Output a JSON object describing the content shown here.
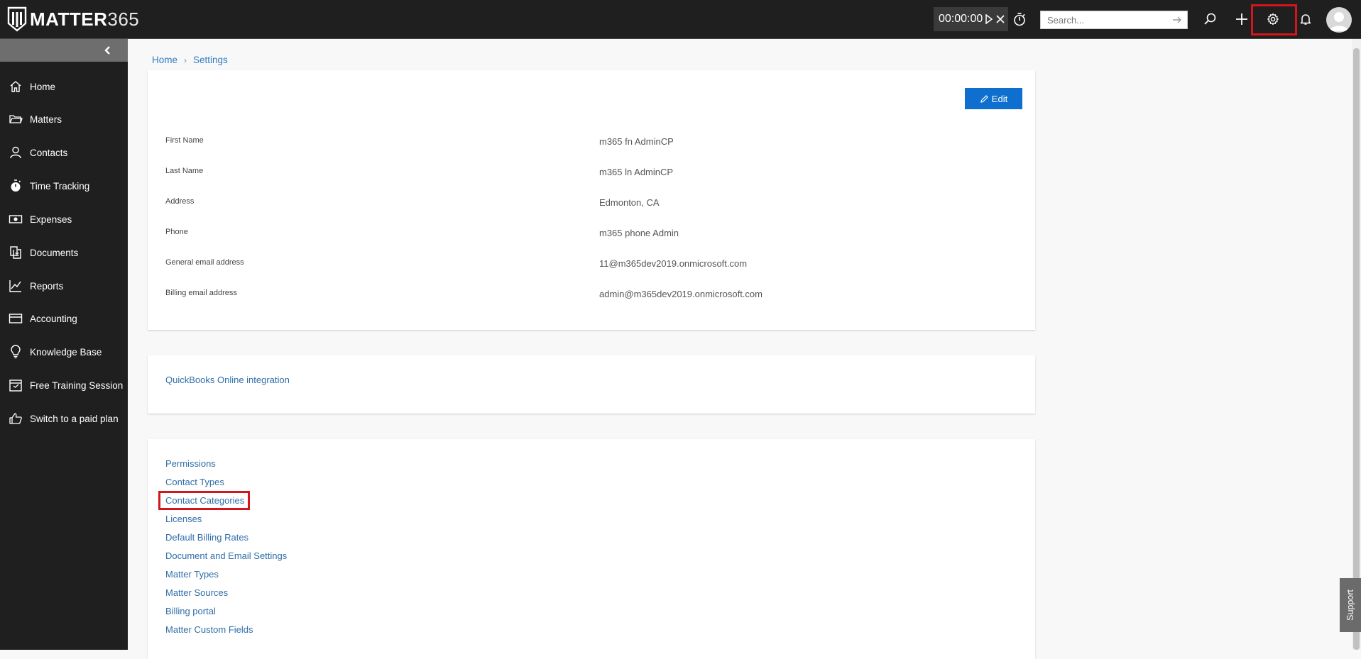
{
  "app": {
    "logo_text": "MATTER",
    "logo_number": "365"
  },
  "topbar": {
    "timer": "00:00:00",
    "search_placeholder": "Search..."
  },
  "sidebar": {
    "items": [
      {
        "label": "Home",
        "icon": "home-icon"
      },
      {
        "label": "Matters",
        "icon": "folder-icon"
      },
      {
        "label": "Contacts",
        "icon": "person-icon"
      },
      {
        "label": "Time Tracking",
        "icon": "stopwatch-icon"
      },
      {
        "label": "Expenses",
        "icon": "money-icon"
      },
      {
        "label": "Documents",
        "icon": "documents-icon"
      },
      {
        "label": "Reports",
        "icon": "chart-icon"
      },
      {
        "label": "Accounting",
        "icon": "card-icon"
      },
      {
        "label": "Knowledge Base",
        "icon": "lightbulb-icon"
      },
      {
        "label": "Free Training Session",
        "icon": "calendar-icon"
      },
      {
        "label": "Switch to a paid plan",
        "icon": "thumbs-up-icon"
      }
    ]
  },
  "breadcrumb": {
    "home": "Home",
    "current": "Settings"
  },
  "profile": {
    "edit_label": "Edit",
    "fields": [
      {
        "label": "First Name",
        "value": "m365 fn AdminCP"
      },
      {
        "label": "Last Name",
        "value": "m365 ln AdminCP"
      },
      {
        "label": "Address",
        "value": "Edmonton, CA"
      },
      {
        "label": "Phone",
        "value": "m365 phone Admin"
      },
      {
        "label": "General email address",
        "value": "11@m365dev2019.onmicrosoft.com"
      },
      {
        "label": "Billing email address",
        "value": "admin@m365dev2019.onmicrosoft.com"
      }
    ]
  },
  "integration": {
    "quickbooks": "QuickBooks Online integration"
  },
  "settings_links": [
    "Permissions",
    "Contact Types",
    "Contact Categories",
    "Licenses",
    "Default Billing Rates",
    "Document and Email Settings",
    "Matter Types",
    "Matter Sources",
    "Billing portal",
    "Matter Custom Fields"
  ],
  "support_label": "Support",
  "colors": {
    "accent": "#0f6fce",
    "link": "#2f6ea7",
    "highlight": "#d4161c",
    "sidebar": "#1f1f1f"
  }
}
